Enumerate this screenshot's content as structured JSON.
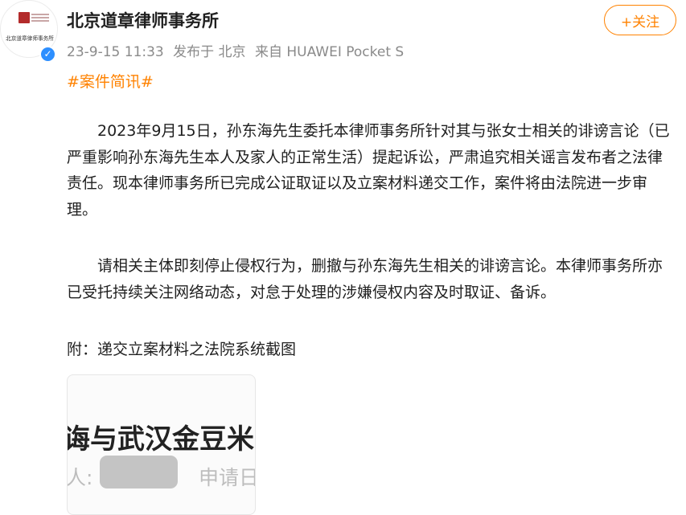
{
  "account": {
    "name": "北京道章律师事务所",
    "avatar_text": "北京道章律师事务所",
    "verified_icon": "verified-badge-icon",
    "follow_label": "+关注"
  },
  "meta": {
    "date": "23-9-15 11:33",
    "location": "发布于 北京",
    "device": "来自 HUAWEI Pocket S"
  },
  "post": {
    "tag": "#案件简讯#",
    "paragraph1": "2023年9月15日，孙东海先生委托本律师事务所针对其与张女士相关的诽谤言论（已严重影响孙东海先生本人及家人的正常生活）提起诉讼，严肃追究相关谣言发布者之法律责任。现本律师事务所已完成公证取证以及立案材料递交工作，案件将由法院进一步审理。",
    "paragraph2": "请相关主体即刻停止侵权行为，删撤与孙东海先生相关的诽谤言论。本律师事务所亦已受托持续关注网络动态，对怠于处理的涉嫌侵权内容及时取证、备诉。",
    "attachment_caption": "附：递交立案材料之法院系统截图"
  },
  "image": {
    "title_fragment": "诲与武汉金豆米",
    "label_fragment": "人:",
    "date_fragment": "申请日"
  },
  "colors": {
    "accent": "#ff8200",
    "verified": "#2d8fff",
    "meta_text": "#8a8a8a"
  }
}
